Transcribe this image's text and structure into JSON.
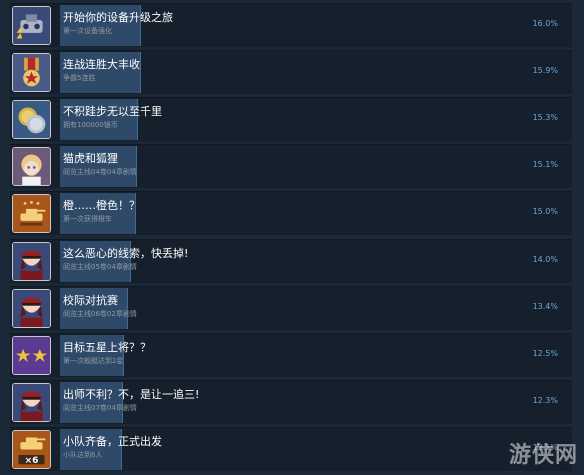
{
  "achievements": [
    {
      "title": "开始你的设备升级之旅",
      "desc": "第一次设备强化",
      "percent": "16.0%",
      "icon": "robot-icon",
      "bar_fraction": 0.16
    },
    {
      "title": "连战连胜大丰收",
      "desc": "争霸5连胜",
      "percent": "15.9%",
      "icon": "medal-icon",
      "bar_fraction": 0.159
    },
    {
      "title": "不积跬步无以至千里",
      "desc": "拥有100000银币",
      "percent": "15.3%",
      "icon": "coins-icon",
      "bar_fraction": 0.153
    },
    {
      "title": "猫虎和狐狸",
      "desc": "阅览主线04卷04章剧情",
      "percent": "15.1%",
      "icon": "girl-portrait-icon",
      "bar_fraction": 0.151
    },
    {
      "title": "橙……橙色！？",
      "desc": "第一次获得橙车",
      "percent": "15.0%",
      "icon": "orange-tank-icon",
      "bar_fraction": 0.15
    },
    {
      "title": "这么恶心的线索，快丢掉!",
      "desc": "阅览主线05卷04章剧情",
      "percent": "14.0%",
      "icon": "officer-portrait-icon",
      "bar_fraction": 0.14
    },
    {
      "title": "校际对抗赛",
      "desc": "阅览主线06卷02章剧情",
      "percent": "13.4%",
      "icon": "officer-portrait-icon",
      "bar_fraction": 0.134
    },
    {
      "title": "目标五星上将？？",
      "desc": "第一次舰艇达到2星",
      "percent": "12.5%",
      "icon": "two-stars-icon",
      "bar_fraction": 0.125
    },
    {
      "title": "出师不利？不，是让一追三!",
      "desc": "阅览主线07卷04章剧情",
      "percent": "12.3%",
      "icon": "officer-portrait-icon",
      "bar_fraction": 0.123
    },
    {
      "title": "小队齐备，正式出发",
      "desc": "小队达到6人",
      "percent": "12.1%",
      "icon": "tank-squad-icon",
      "icon_badge": "×6",
      "bar_fraction": 0.121
    }
  ],
  "watermark": "游侠网",
  "colors": {
    "background": "#1b2838",
    "row": "#16202d",
    "bar": "#2f4a68",
    "percent": "#67a8d8",
    "title": "#ffffff",
    "desc": "#8f98a0"
  }
}
